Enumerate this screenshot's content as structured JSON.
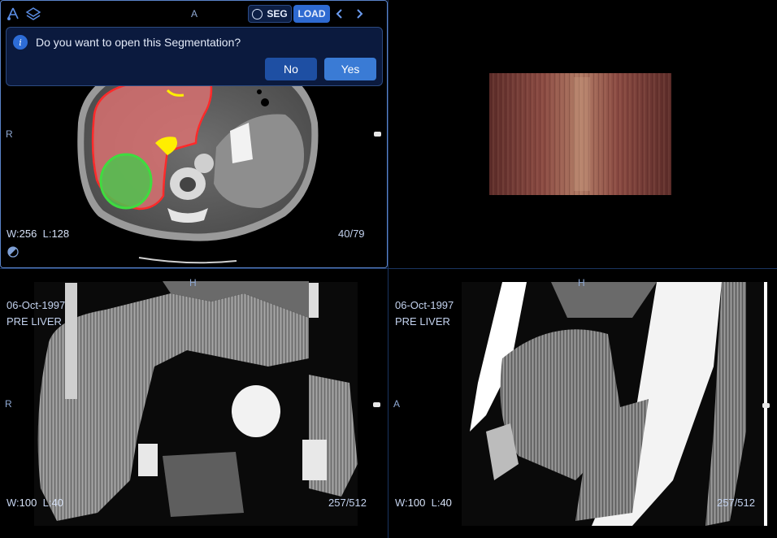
{
  "toolbar": {
    "orientation_top": "A",
    "seg_label": "SEG",
    "load_label": "LOAD",
    "icons": [
      "viewport-logo-icon",
      "layers-icon",
      "seg-circle-icon",
      "chevron-left-icon",
      "chevron-right-icon"
    ]
  },
  "dialog": {
    "message": "Do you want to open this Segmentation?",
    "no_label": "No",
    "yes_label": "Yes",
    "icon": "info-icon"
  },
  "viewports": {
    "axial": {
      "left_marker": "R",
      "window": "256",
      "level": "128",
      "w_label": "W:",
      "l_label": "L:",
      "slice": "40/79"
    },
    "coronal": {
      "date": "06-Oct-1997",
      "series": "PRE LIVER",
      "top_marker": "H",
      "left_marker": "R",
      "w_label": "W:",
      "l_label": "L:",
      "window": "100",
      "level": "40",
      "slice": "257/512"
    },
    "sagittal": {
      "date": "06-Oct-1997",
      "series": "PRE LIVER",
      "top_marker": "H",
      "left_marker": "A",
      "w_label": "W:",
      "l_label": "L:",
      "window": "100",
      "level": "40",
      "slice": "257/512"
    }
  },
  "colors": {
    "accent": "#3a7bd5",
    "viewport_border": "#5a83c9",
    "dialog_bg": "#0b1a3e",
    "seg_red": "#e23b3b",
    "seg_green": "#3fdc3f",
    "seg_yellow": "#ffee00"
  }
}
